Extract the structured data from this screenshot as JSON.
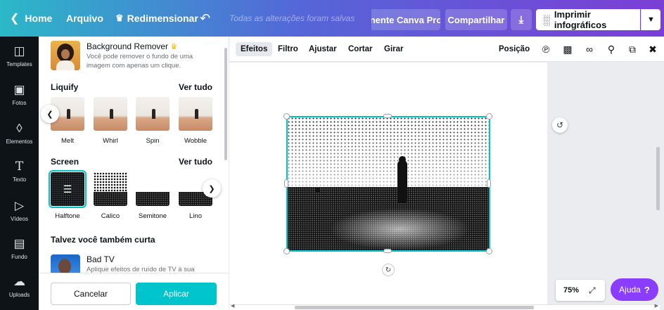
{
  "topbar": {
    "home": "Home",
    "file": "Arquivo",
    "resize": "Redimensionar",
    "saved_status": "Todas as alterações foram salvas",
    "try_pro": "nente Canva Pro",
    "share": "Compartilhar",
    "print": "Imprimir infográficos"
  },
  "rail": {
    "items": [
      {
        "label": "Templates",
        "icon": "layout-icon"
      },
      {
        "label": "Fotos",
        "icon": "photo-icon"
      },
      {
        "label": "Elementos",
        "icon": "shapes-icon"
      },
      {
        "label": "Texto",
        "icon": "text-icon"
      },
      {
        "label": "Vídeos",
        "icon": "video-icon"
      },
      {
        "label": "Fundo",
        "icon": "background-icon"
      },
      {
        "label": "Uploads",
        "icon": "cloud-upload-icon"
      }
    ]
  },
  "panel": {
    "bg_remover": {
      "title": "Background Remover",
      "desc": "Você pode remover o fundo de uma imagem com apenas um clique."
    },
    "liquify": {
      "title": "Liquify",
      "see_all": "Ver tudo",
      "items": [
        "Melt",
        "Whirl",
        "Spin",
        "Wobble"
      ]
    },
    "screen": {
      "title": "Screen",
      "see_all": "Ver tudo",
      "items": [
        "Halftone",
        "Calico",
        "Semitone",
        "Lino"
      ],
      "selected": "Halftone"
    },
    "suggest": {
      "title": "Talvez você também curta",
      "item_title": "Bad TV",
      "item_desc": "Aplique efeitos de ruído de TV à sua"
    },
    "cancel": "Cancelar",
    "apply": "Aplicar"
  },
  "toolbar": {
    "effects": "Efeitos",
    "filter": "Filtro",
    "adjust": "Ajustar",
    "crop": "Cortar",
    "rotate": "Girar",
    "position": "Posição"
  },
  "canvas": {
    "zoom": "75%",
    "help": "Ajuda",
    "help_mark": "?"
  },
  "colors": {
    "accent": "#00c4cc",
    "help": "#8b3dff",
    "rail": "#0e1318"
  }
}
